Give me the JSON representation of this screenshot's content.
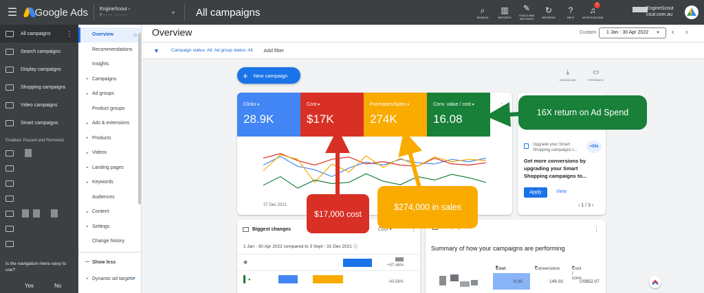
{
  "topbar": {
    "app_name": "Google Ads",
    "account_name": "EngineScout",
    "account_sub": "F----  ------",
    "page_title": "All campaigns",
    "tools": [
      {
        "icon": "search-icon",
        "glyph": "⌕",
        "label": "SEARCH"
      },
      {
        "icon": "reports-icon",
        "glyph": "▥",
        "label": "REPORTS"
      },
      {
        "icon": "wrench-icon",
        "glyph": "✎",
        "label": "TOOLS AND SETTINGS"
      },
      {
        "icon": "refresh-icon",
        "glyph": "↻",
        "label": "REFRESH"
      },
      {
        "icon": "help-icon",
        "glyph": "?",
        "label": "HELP"
      },
      {
        "icon": "bell-icon",
        "glyph": "♫",
        "label": "NOTIFICATIONS"
      }
    ],
    "notification_count": "!",
    "user_line1": "EngineScout",
    "user_line2": "cout.com.au"
  },
  "leftnav": {
    "items": [
      {
        "label": "All campaigns"
      },
      {
        "label": "Search campaigns"
      },
      {
        "label": "Display campaigns"
      },
      {
        "label": "Shopping campaigns"
      },
      {
        "label": "Video campaigns"
      },
      {
        "label": "Smart campaigns"
      }
    ],
    "section_label": "Enabled, Paused and Removed",
    "survey_question": "Is the navigation menu easy to use?",
    "survey_yes": "Yes",
    "survey_no": "No"
  },
  "subnav": {
    "items": [
      {
        "label": "Overview"
      },
      {
        "label": "Recommendations"
      },
      {
        "label": "Insights"
      },
      {
        "label": "Campaigns"
      },
      {
        "label": "Ad groups"
      },
      {
        "label": "Product groups"
      },
      {
        "label": "Ads & extensions"
      },
      {
        "label": "Products"
      },
      {
        "label": "Videos"
      },
      {
        "label": "Landing pages"
      },
      {
        "label": "Keywords"
      },
      {
        "label": "Audiences"
      },
      {
        "label": "Content"
      },
      {
        "label": "Settings"
      },
      {
        "label": "Change history"
      }
    ],
    "show_less": "Show less",
    "dynamic_ad_targets": "Dynamic ad targets"
  },
  "main": {
    "title": "Overview",
    "date_mode": "Custom",
    "date_range": "1 Jan - 30 Apr 2022",
    "filter_text": "Campaign status: All; Ad group status: All",
    "add_filter": "Add filter",
    "new_campaign": "New campaign",
    "download_label": "DOWNLOAD",
    "feedback_label": "FEEDBACK"
  },
  "metrics": [
    {
      "name": "Clicks",
      "value": "28.9K",
      "color": "#4285f4"
    },
    {
      "name": "Cost",
      "value": "$17K",
      "color": "#d93025"
    },
    {
      "name": "Purchases/Sales",
      "value": "274K",
      "color": "#f9ab00"
    },
    {
      "name": "Conv. value / cost",
      "value": "16.08",
      "color": "#188038"
    }
  ],
  "chart_date_label": "27 Dec 2021",
  "upgrade_card": {
    "small_text": "Upgrade your Smart Shopping campaigns t...",
    "pct": "+5%",
    "title": "Get more conversions by upgrading your Smart Shopping campaigns to...",
    "apply": "Apply",
    "view": "View",
    "pager": "1 / 3"
  },
  "changes": {
    "title": "Biggest changes",
    "metric_select": "Cost",
    "compare": "1 Jan - 30 Apr 2022 compared to 3 Sept - 31 Dec 2021",
    "rows": [
      {
        "change": "+57.46%"
      },
      {
        "change": "-43.58%"
      }
    ]
  },
  "campaigns": {
    "title": "Campaigns",
    "summary": "Summary of how your campaigns are performing",
    "col_cost": "Cost",
    "col_conversions": "Conversions",
    "col_cost_conv": "Cost / conv.",
    "row": {
      "cost": "9.33",
      "conversions": "149.03",
      "cost_conv": "US$52.07"
    }
  },
  "annotations": {
    "cost": "$17,000 cost",
    "sales": "$274,000 in sales",
    "roas": "16X return on Ad Spend"
  },
  "chart_data": {
    "type": "line",
    "x": [
      1,
      2,
      3,
      4,
      5,
      6,
      7,
      8,
      9,
      10,
      11,
      12,
      13,
      14
    ],
    "series": [
      {
        "color": "#4285f4",
        "values": [
          60,
          75,
          58,
          52,
          40,
          55,
          65,
          60,
          70,
          64,
          62,
          70,
          66,
          72
        ]
      },
      {
        "color": "#d93025",
        "values": [
          72,
          80,
          68,
          60,
          70,
          74,
          62,
          66,
          60,
          58,
          72,
          62,
          60,
          64
        ]
      },
      {
        "color": "#f9ab00",
        "values": [
          50,
          78,
          70,
          30,
          62,
          48,
          76,
          56,
          72,
          58,
          74,
          66,
          70,
          68
        ]
      },
      {
        "color": "#188038",
        "values": [
          25,
          40,
          20,
          34,
          28,
          30,
          45,
          32,
          26,
          40,
          34,
          44,
          38,
          30
        ]
      }
    ],
    "xlabel": "",
    "ylabel": "",
    "ylim": [
      0,
      100
    ],
    "grid": false
  }
}
